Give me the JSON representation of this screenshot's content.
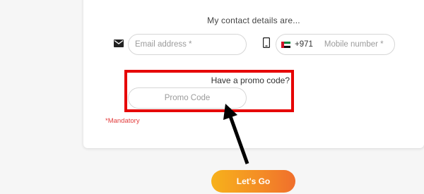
{
  "contact": {
    "heading": "My contact details are...",
    "email_placeholder": "Email address *",
    "dial_code": "+971",
    "mobile_placeholder": "Mobile number *"
  },
  "promo": {
    "question": "Have a promo code?",
    "placeholder": "Promo Code"
  },
  "mandatory_note": "*Mandatory",
  "submit_label": "Let's Go",
  "icons": {
    "email": "envelope-icon",
    "phone": "mobile-phone-icon",
    "flag": "uae-flag-icon"
  },
  "colors": {
    "highlight": "#e60000",
    "button_start": "#f7b11b",
    "button_end": "#f06f2c",
    "mandatory": "#e23b3b"
  }
}
